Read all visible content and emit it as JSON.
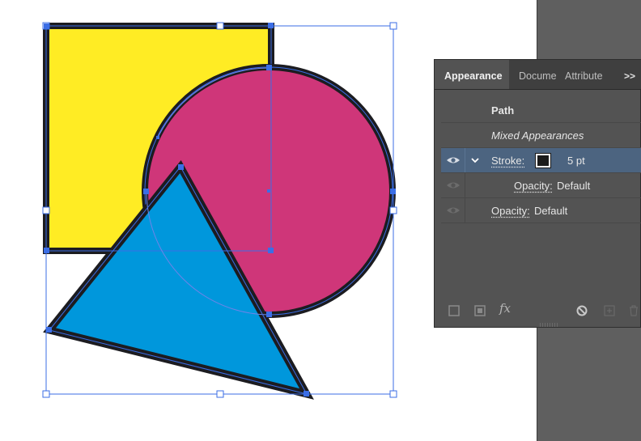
{
  "panel": {
    "tabs": [
      {
        "label": "Appearance",
        "active": true
      },
      {
        "label": "Docume",
        "active": false
      },
      {
        "label": "Attribute",
        "active": false
      }
    ],
    "more_label": ">>",
    "rows": {
      "path": "Path",
      "mixed": "Mixed Appearances",
      "stroke_label": "Stroke:",
      "stroke_weight": "5 pt",
      "stroke_opacity_label": "Opacity:",
      "stroke_opacity_value": "Default",
      "opacity_label": "Opacity:",
      "opacity_value": "Default"
    },
    "footer_icons": [
      "new-stroke-icon",
      "new-fill-icon",
      "fx-icon",
      "clear-appearance-icon",
      "duplicate-item-icon",
      "delete-item-icon"
    ],
    "fx_label": "fx"
  },
  "artwork": {
    "shapes": [
      {
        "kind": "square",
        "fill": "#ffec24"
      },
      {
        "kind": "circle",
        "fill": "#cf3679"
      },
      {
        "kind": "triangle",
        "fill": "#0097dc"
      }
    ],
    "stroke_color": "#1c1c20",
    "selection_color": "#3b6ee6"
  },
  "colors": {
    "panel_bg": "#535353",
    "tab_bg": "#3f3f3f",
    "selected_row": "#4c6480",
    "pasteboard": "#5f5f5f"
  }
}
